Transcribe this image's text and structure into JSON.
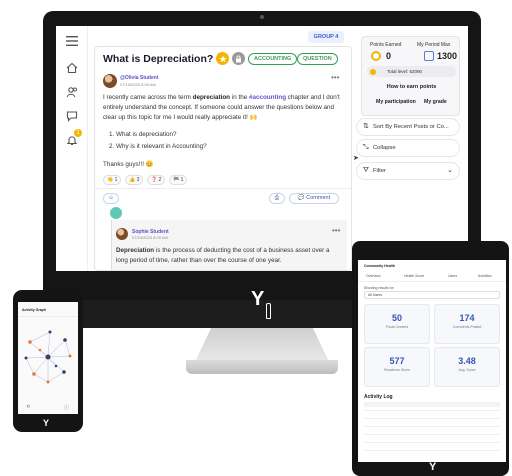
{
  "post": {
    "title": "What is Depreciation?",
    "tags": [
      "ACCOUNTING",
      "QUESTION"
    ],
    "author": "@Olivia Student",
    "author_meta": "07/19/2023 8:00 AM",
    "body_pre": "I recently came across the term ",
    "body_term": "depreciation",
    "body_mid": " in the ",
    "body_hashtag": "#accounting",
    "body_post": " chapter and I don't entirely understand the concept. If someone could answer the questions below and clear up this topic for me I would really appreciate it! 🙌",
    "questions": [
      "1.  What is depreciation?",
      "2.  Why is it relevant in Accounting?"
    ],
    "thanks": "Thanks guys!!! 😊",
    "reactions": [
      "👏 1",
      "👍 3",
      "❓ 2",
      "🏁 1"
    ],
    "comment_label": "Comment"
  },
  "reply": {
    "author": "Sophie Student",
    "meta": "07/19/2023 8:00 AM",
    "term": "Depreciation",
    "text": " is the process of deducting the cost of a business asset over a long period of time, rather than over the course of one year."
  },
  "sidebar": {
    "notification_count": "1"
  },
  "group_label": "GROUP 4",
  "points": {
    "earned_label": "Points Earned",
    "earned_value": "0",
    "max_label": "My Period Max",
    "max_value": "1300",
    "total_label": "Total level: 52090",
    "how_label": "How to earn points",
    "participation_label": "My participation",
    "grade_label": "My grade"
  },
  "panel": {
    "sort_label": "Sort  By Recent Posts or Co...",
    "collapse_label": "Collapse",
    "filter_label": "Filter"
  },
  "brand": {
    "logo": "Y"
  },
  "phone": {
    "title": "Activity Graph"
  },
  "tablet": {
    "title": "Community Health",
    "tabs": [
      "Overview",
      "Health Score",
      "Users",
      "Activities"
    ],
    "filter_label": "Showing results for",
    "filter_value": "All Users",
    "stats": [
      {
        "value": "50",
        "label": "Posts Created"
      },
      {
        "value": "174",
        "label": "Comments Posted"
      },
      {
        "value": "577",
        "label": "Reactions Given"
      },
      {
        "value": "3.48",
        "label": "Avg. Score"
      }
    ],
    "log_title": "Activity Log"
  },
  "colors": {
    "accent": "#5b4fc9",
    "tag_green": "#3a9d5d",
    "link_blue": "#3556b3",
    "emoji_yellow": "#f4b400"
  }
}
